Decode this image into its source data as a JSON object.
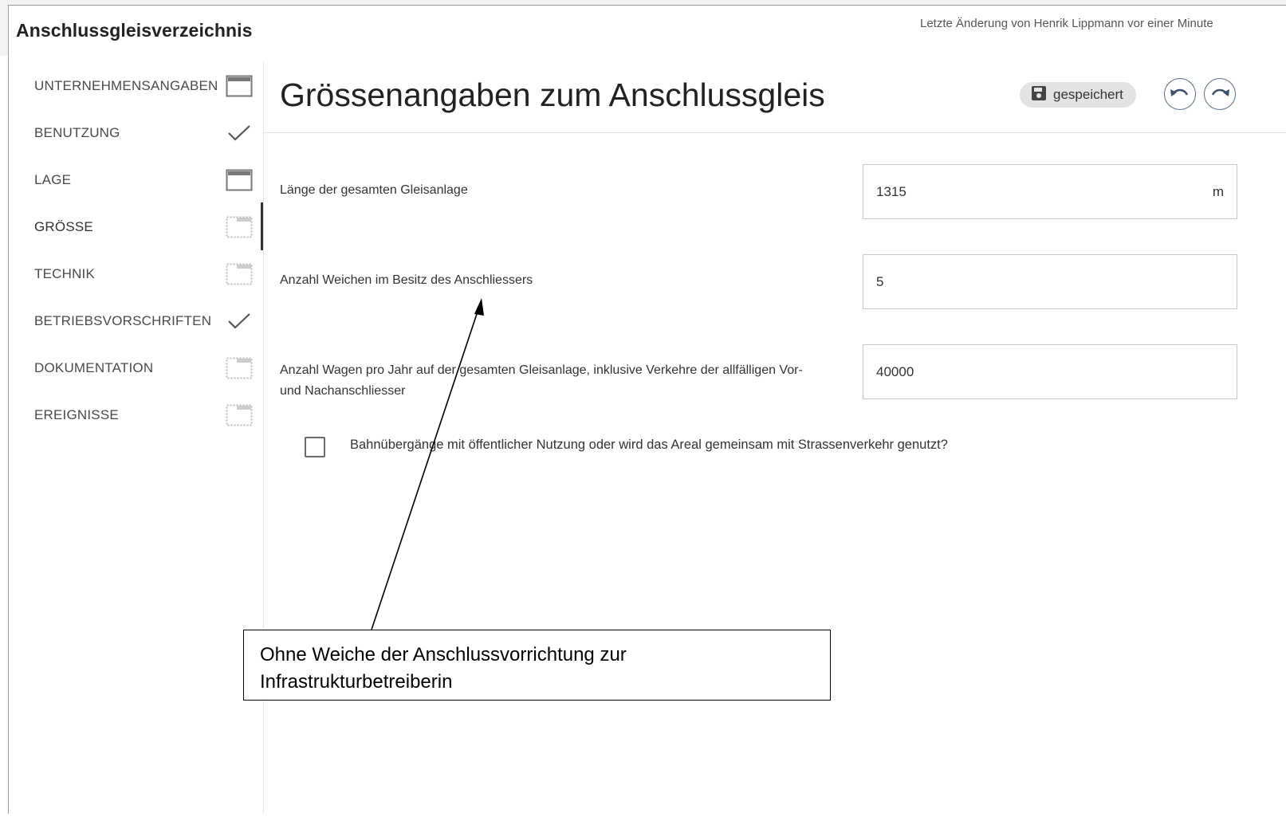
{
  "app": {
    "title": "Anschlussgleisverzeichnis",
    "last_change": "Letzte Änderung von Henrik Lippmann vor einer Minute"
  },
  "sidebar": {
    "items": [
      {
        "label": "UNTERNEHMENSANGABEN",
        "status": "page-icon"
      },
      {
        "label": "BENUTZUNG",
        "status": "check-icon"
      },
      {
        "label": "LAGE",
        "status": "page-icon"
      },
      {
        "label": "GRÖSSE",
        "status": "page-dashed-icon",
        "active": true
      },
      {
        "label": "TECHNIK",
        "status": "page-dashed-icon"
      },
      {
        "label": "BETRIEBSVORSCHRIFTEN",
        "status": "check-icon"
      },
      {
        "label": "DOKUMENTATION",
        "status": "page-dashed-icon"
      },
      {
        "label": "EREIGNISSE",
        "status": "page-dashed-icon"
      }
    ]
  },
  "main": {
    "title": "Grössenangaben zum Anschlussgleis",
    "saved_label": "gespeichert",
    "fields": [
      {
        "label": "Länge der gesamten Gleisanlage",
        "value": "1315",
        "unit": "m"
      },
      {
        "label": "Anzahl Weichen im Besitz des Anschliessers",
        "value": "5"
      },
      {
        "label": "Anzahl Wagen pro Jahr auf der gesamten Gleisanlage, inklusive Verkehre der allfälligen Vor-\nund Nachanschliesser",
        "value": "40000"
      }
    ],
    "checkbox": {
      "label": "Bahnübergänge mit öffentlicher Nutzung oder wird das Areal gemeinsam mit Strassenverkehr genutzt?",
      "checked": false
    }
  },
  "annotation": {
    "text": "Ohne Weiche der Anschlussvorrichtung zur Infrastrukturbetreiberin"
  },
  "colors": {
    "topbar_bg": "#f3f3f3",
    "icon_button_border": "#5b6f86",
    "chip_bg": "#e3e3e3"
  }
}
